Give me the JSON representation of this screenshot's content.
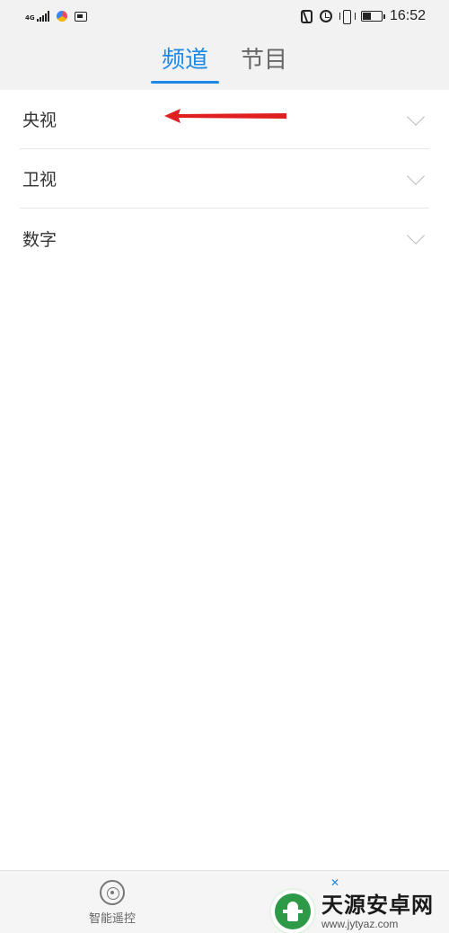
{
  "status_bar": {
    "network": "4G",
    "time": "16:52",
    "battery_level": 0.45
  },
  "tabs": [
    {
      "label": "频道",
      "active": true
    },
    {
      "label": "节目",
      "active": false
    }
  ],
  "channel_categories": [
    {
      "label": "央视"
    },
    {
      "label": "卫视"
    },
    {
      "label": "数字"
    }
  ],
  "annotation": {
    "color": "#e02020",
    "icon": "arrow-left-icon"
  },
  "bottom_nav": {
    "items": [
      {
        "label": "智能遥控",
        "icon": "remote-control-icon"
      }
    ]
  },
  "watermark": {
    "title": "天源安卓网",
    "url": "www.jytyaz.com"
  },
  "colors": {
    "accent": "#1e88e5",
    "header_bg": "#f2f2f2"
  }
}
